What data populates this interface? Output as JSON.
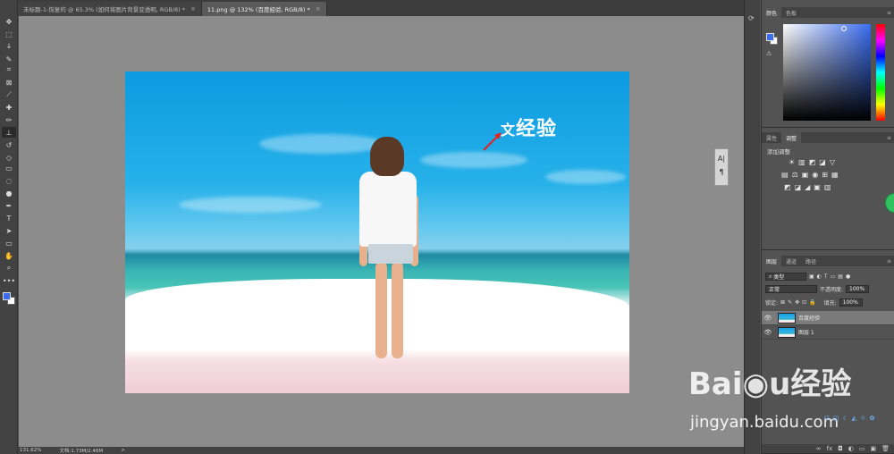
{
  "tabs": [
    {
      "label": "未标题-1-恢复的 @ 65.3% (如何将图片背景变透明, RGB/8) *",
      "active": false
    },
    {
      "label": "11.png @ 132% (百度经验, RGB/8) *",
      "active": true
    }
  ],
  "tab_close": "×",
  "tools": [
    {
      "name": "move-tool",
      "glyph": "✥"
    },
    {
      "name": "marquee-tool",
      "glyph": "⬚"
    },
    {
      "name": "lasso-tool",
      "glyph": "ↆ"
    },
    {
      "name": "quick-select-tool",
      "glyph": "✎"
    },
    {
      "name": "crop-tool",
      "glyph": "⌗"
    },
    {
      "name": "frame-tool",
      "glyph": "⊠"
    },
    {
      "name": "eyedropper-tool",
      "glyph": "⟋"
    },
    {
      "name": "healing-tool",
      "glyph": "✚"
    },
    {
      "name": "brush-tool",
      "glyph": "✏"
    },
    {
      "name": "stamp-tool",
      "glyph": "⊥"
    },
    {
      "name": "history-brush-tool",
      "glyph": "↺"
    },
    {
      "name": "eraser-tool",
      "glyph": "◇"
    },
    {
      "name": "gradient-tool",
      "glyph": "▭"
    },
    {
      "name": "blur-tool",
      "glyph": "◌"
    },
    {
      "name": "dodge-tool",
      "glyph": "●"
    },
    {
      "name": "pen-tool",
      "glyph": "✒"
    },
    {
      "name": "type-tool",
      "glyph": "T"
    },
    {
      "name": "path-select-tool",
      "glyph": "➤"
    },
    {
      "name": "shape-tool",
      "glyph": "▭"
    },
    {
      "name": "hand-tool",
      "glyph": "✋"
    },
    {
      "name": "zoom-tool",
      "glyph": "⌕"
    },
    {
      "name": "more-tools",
      "glyph": "•••"
    }
  ],
  "canvas": {
    "watermark_text": "经验",
    "watermark_prefix": "文"
  },
  "mini_panel": {
    "icon1": "A|",
    "icon2": "¶"
  },
  "status": {
    "zoom": "131.62%",
    "doc": "文档:1.73M/2.46M",
    "arrow": ">"
  },
  "color_panel": {
    "tab1": "颜色",
    "tab2": "色板",
    "warn": "⚠"
  },
  "adjust_panel": {
    "tab1": "属性",
    "tab2": "调整",
    "title": "添加调整",
    "row1": [
      "☀",
      "▥",
      "◩",
      "◪",
      "▽"
    ],
    "row2": [
      "▤",
      "⚖",
      "▣",
      "◉",
      "⊞",
      "▦"
    ],
    "row3": [
      "◩",
      "◪",
      "◢",
      "▣",
      "▥"
    ]
  },
  "layers_panel": {
    "tab1": "图层",
    "tab2": "通道",
    "tab3": "路径",
    "kind_label": "类型",
    "blend_mode": "正常",
    "opacity_label": "不透明度:",
    "opacity_value": "100%",
    "lock_label": "锁定:",
    "fill_label": "填充:",
    "fill_value": "100%",
    "layers": [
      {
        "name": "百度经验",
        "selected": true
      },
      {
        "name": "图层 1",
        "selected": false
      }
    ],
    "footer_icons": [
      "∞",
      "fx",
      "◘",
      "◐",
      "▭",
      "▣",
      "🗑"
    ]
  },
  "panel_menu": "≡",
  "watermark": {
    "logo": "Bai◉u经验",
    "url": "jingyan.baidu.com"
  },
  "bottom_mini_icons": [
    "⊡",
    "◫",
    "☾",
    "◭",
    "☼",
    "✿"
  ]
}
